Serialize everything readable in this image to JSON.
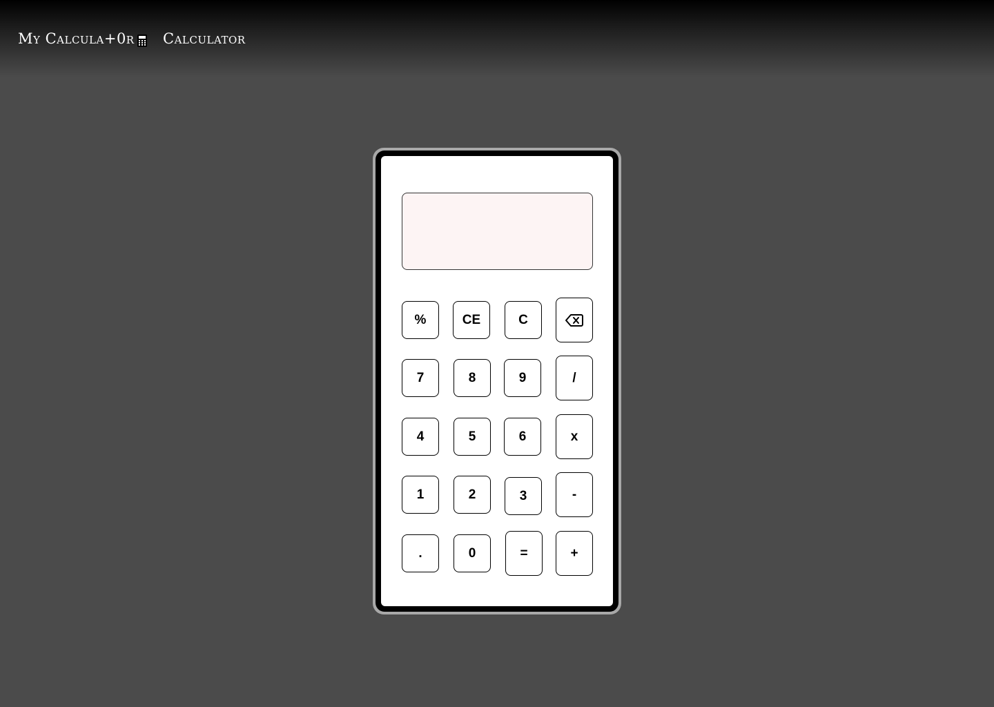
{
  "header": {
    "brand_text": "My Calcula+0r",
    "brand_icon": "calculator-icon",
    "nav_link": "Calculator"
  },
  "calculator": {
    "display": {
      "value": "",
      "placeholder": ""
    },
    "keys": {
      "percent": "%",
      "clear_entry": "CE",
      "clear": "C",
      "backspace_icon": "backspace-icon",
      "seven": "7",
      "eight": "8",
      "nine": "9",
      "divide": "/",
      "four": "4",
      "five": "5",
      "six": "6",
      "multiply": "x",
      "one": "1",
      "two": "2",
      "three": "3",
      "minus": "-",
      "decimal": ".",
      "zero": "0",
      "equals": "=",
      "plus": "+"
    }
  }
}
